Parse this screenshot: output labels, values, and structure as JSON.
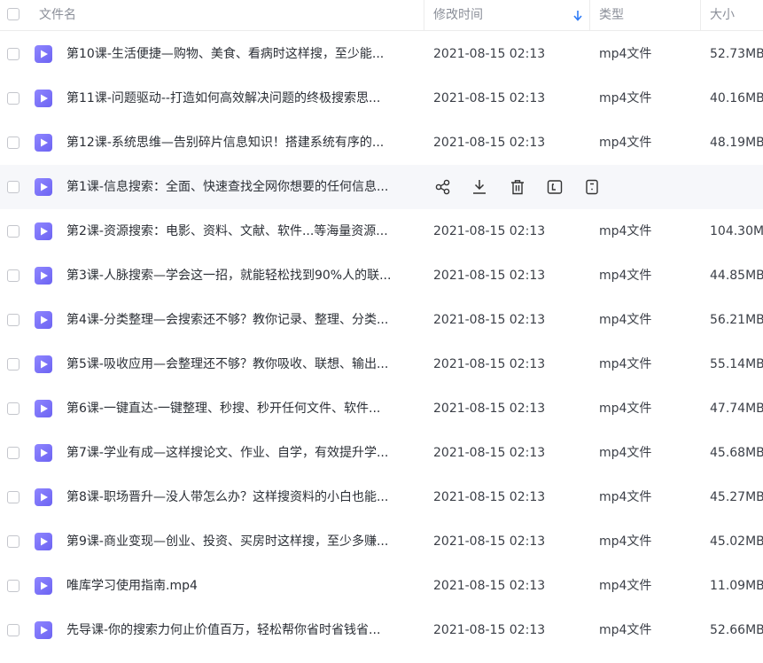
{
  "header": {
    "name_label": "文件名",
    "modified_label": "修改时间",
    "type_label": "类型",
    "size_label": "大小"
  },
  "rows": [
    {
      "name": "第10课-生活便捷—购物、美食、看病时这样搜，至少能...",
      "modified": "2021-08-15 02:13",
      "type": "mp4文件",
      "size": "52.73MB"
    },
    {
      "name": "第11课-问题驱动--打造如何高效解决问题的终极搜索思...",
      "modified": "2021-08-15 02:13",
      "type": "mp4文件",
      "size": "40.16MB"
    },
    {
      "name": "第12课-系统思维—告别碎片信息知识！搭建系统有序的...",
      "modified": "2021-08-15 02:13",
      "type": "mp4文件",
      "size": "48.19MB"
    },
    {
      "name": "第1课-信息搜索：全面、快速查找全网你想要的任何信息...",
      "modified": "",
      "type": "",
      "size": ""
    },
    {
      "name": "第2课-资源搜索：电影、资料、文献、软件...等海量资源...",
      "modified": "2021-08-15 02:13",
      "type": "mp4文件",
      "size": "104.30MB"
    },
    {
      "name": "第3课-人脉搜索—学会这一招，就能轻松找到90%人的联...",
      "modified": "2021-08-15 02:13",
      "type": "mp4文件",
      "size": "44.85MB"
    },
    {
      "name": "第4课-分类整理—会搜索还不够？教你记录、整理、分类...",
      "modified": "2021-08-15 02:13",
      "type": "mp4文件",
      "size": "56.21MB"
    },
    {
      "name": "第5课-吸收应用—会整理还不够？教你吸收、联想、输出...",
      "modified": "2021-08-15 02:13",
      "type": "mp4文件",
      "size": "55.14MB"
    },
    {
      "name": "第6课-一键直达-一键整理、秒搜、秒开任何文件、软件...",
      "modified": "2021-08-15 02:13",
      "type": "mp4文件",
      "size": "47.74MB"
    },
    {
      "name": "第7课-学业有成—这样搜论文、作业、自学，有效提升学...",
      "modified": "2021-08-15 02:13",
      "type": "mp4文件",
      "size": "45.68MB"
    },
    {
      "name": "第8课-职场晋升—没人带怎么办？这样搜资料的小白也能...",
      "modified": "2021-08-15 02:13",
      "type": "mp4文件",
      "size": "45.27MB"
    },
    {
      "name": "第9课-商业变现—创业、投资、买房时这样搜，至少多赚...",
      "modified": "2021-08-15 02:13",
      "type": "mp4文件",
      "size": "45.02MB"
    },
    {
      "name": "唯库学习使用指南.mp4",
      "modified": "2021-08-15 02:13",
      "type": "mp4文件",
      "size": "11.09MB"
    },
    {
      "name": "先导课-你的搜索力何止价值百万，轻松帮你省时省钱省...",
      "modified": "2021-08-15 02:13",
      "type": "mp4文件",
      "size": "52.66MB"
    }
  ],
  "hover_row_actions": [
    "share-icon",
    "download-icon",
    "delete-icon",
    "rename-icon",
    "more-icon"
  ],
  "colors": {
    "accent": "#2f7cf6",
    "file_icon": "#7b72f7",
    "hover_bg": "#f6f7fa"
  }
}
